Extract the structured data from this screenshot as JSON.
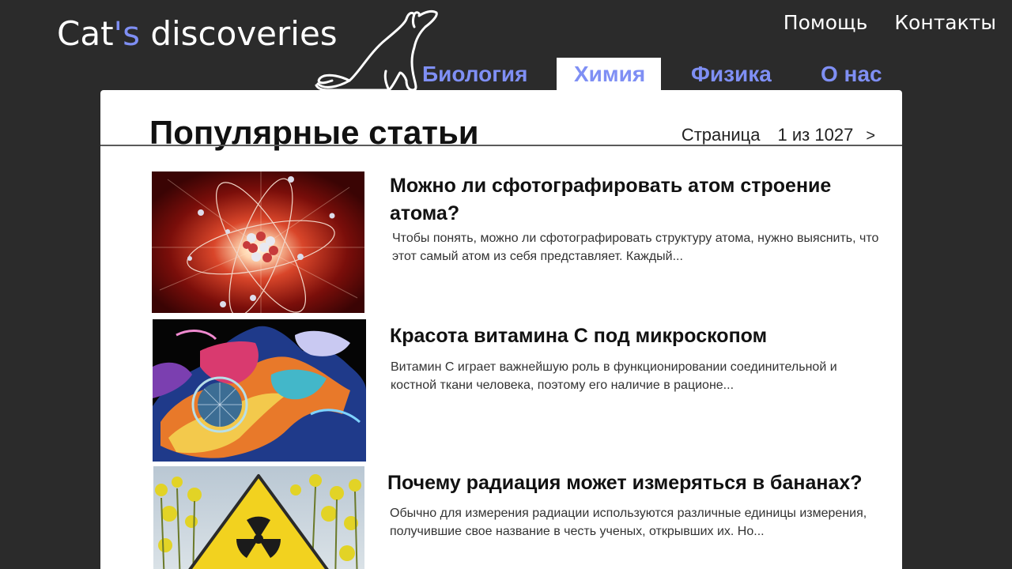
{
  "header": {
    "logo_main": "Cat",
    "logo_accent": "'s",
    "logo_rest": " discoveries",
    "links": [
      "Помощь",
      "Контакты"
    ]
  },
  "nav": {
    "tabs": [
      {
        "label": "Биология",
        "active": false
      },
      {
        "label": "Химия",
        "active": true
      },
      {
        "label": "Физика",
        "active": false
      },
      {
        "label": "О нас",
        "active": false
      }
    ]
  },
  "main": {
    "title": "Популярные статьи",
    "pager": {
      "label": "Страница",
      "current": "1 из 1027",
      "next": ">"
    },
    "articles": [
      {
        "title": "Можно ли сфотографировать атом строение атома?",
        "text": "Чтобы понять, можно ли сфотографировать структуру атома, нужно выяснить, что этот самый атом из себя представляет. Каждый..."
      },
      {
        "title": "Красота витамина С под микроскопом",
        "text": "Витамин С играет важнейшую роль в функционировании соединительной и костной ткани человека, поэтому его наличие в рационе..."
      },
      {
        "title": "Почему радиация может измеряться в бананах?",
        "text": "Обычно для измерения радиации используются различные единицы измерения, получившие свое название в честь ученых, открывших их. Но..."
      }
    ]
  },
  "colors": {
    "background": "#2b2b2b",
    "accent": "#7f8ff4",
    "panel": "#ffffff"
  }
}
